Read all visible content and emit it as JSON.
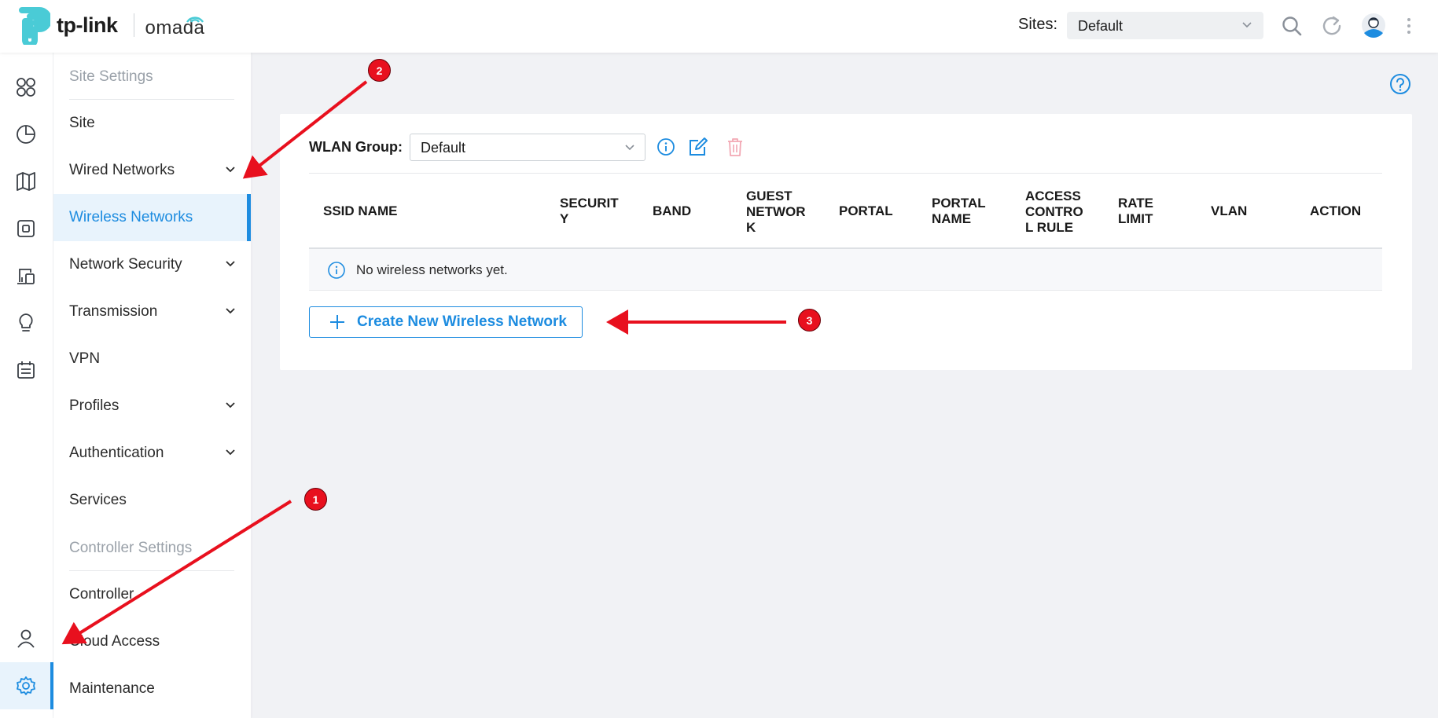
{
  "header": {
    "brand": "tp-link",
    "product": "omada",
    "sites_label": "Sites:",
    "site_selected": "Default"
  },
  "rail": {
    "icons": [
      "dashboard-icon",
      "statistics-icon",
      "map-icon",
      "devices-icon",
      "clients-icon",
      "insights-icon",
      "logs-icon",
      "account-icon",
      "settings-icon"
    ]
  },
  "menu": {
    "section_site": "Site Settings",
    "items": [
      {
        "label": "Site",
        "expandable": false
      },
      {
        "label": "Wired Networks",
        "expandable": true
      },
      {
        "label": "Wireless Networks",
        "expandable": false,
        "active": true
      },
      {
        "label": "Network Security",
        "expandable": true
      },
      {
        "label": "Transmission",
        "expandable": true
      },
      {
        "label": "VPN",
        "expandable": false
      },
      {
        "label": "Profiles",
        "expandable": true
      },
      {
        "label": "Authentication",
        "expandable": true
      },
      {
        "label": "Services",
        "expandable": false
      }
    ],
    "section_controller": "Controller Settings",
    "controller_items": [
      {
        "label": "Controller"
      },
      {
        "label": "Cloud Access"
      },
      {
        "label": "Maintenance"
      }
    ]
  },
  "wlan": {
    "group_label": "WLAN Group:",
    "group_selected": "Default"
  },
  "table": {
    "columns": [
      "SSID NAME",
      "SECURIT\nY",
      "BAND",
      "GUEST\nNETWOR\nK",
      "PORTAL",
      "PORTAL\nNAME",
      "ACCESS\nCONTRO\nL RULE",
      "RATE\nLIMIT",
      "VLAN",
      "ACTION"
    ],
    "empty_text": "No wireless networks yet."
  },
  "create_button": "Create New Wireless Network",
  "annotations": {
    "badge_1": "1",
    "badge_2": "2",
    "badge_3": "3",
    "color": "#e8101e"
  },
  "colors": {
    "accent": "#1d8ce0",
    "logo": "#4acbd6",
    "danger_muted": "#f2a7b3"
  }
}
